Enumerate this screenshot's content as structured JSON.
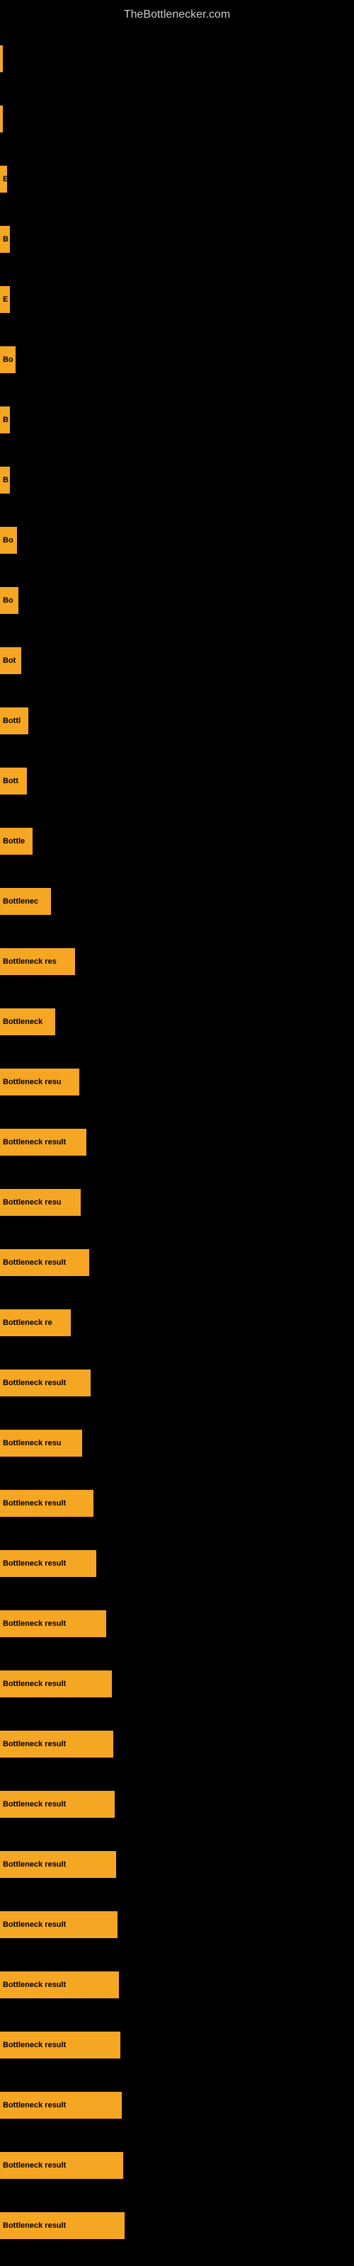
{
  "site": {
    "title": "TheBottlenecker.com"
  },
  "bars": [
    {
      "id": 1,
      "label": "|",
      "width": 4
    },
    {
      "id": 2,
      "label": "|",
      "width": 4
    },
    {
      "id": 3,
      "label": "E",
      "width": 10
    },
    {
      "id": 4,
      "label": "B",
      "width": 14
    },
    {
      "id": 5,
      "label": "E",
      "width": 14
    },
    {
      "id": 6,
      "label": "Bo",
      "width": 22
    },
    {
      "id": 7,
      "label": "B",
      "width": 14
    },
    {
      "id": 8,
      "label": "B",
      "width": 14
    },
    {
      "id": 9,
      "label": "Bo",
      "width": 24
    },
    {
      "id": 10,
      "label": "Bo",
      "width": 26
    },
    {
      "id": 11,
      "label": "Bot",
      "width": 30
    },
    {
      "id": 12,
      "label": "Bottl",
      "width": 40
    },
    {
      "id": 13,
      "label": "Bott",
      "width": 38
    },
    {
      "id": 14,
      "label": "Bottle",
      "width": 46
    },
    {
      "id": 15,
      "label": "Bottlenec",
      "width": 72
    },
    {
      "id": 16,
      "label": "Bottleneck res",
      "width": 106
    },
    {
      "id": 17,
      "label": "Bottleneck",
      "width": 78
    },
    {
      "id": 18,
      "label": "Bottleneck resu",
      "width": 112
    },
    {
      "id": 19,
      "label": "Bottleneck result",
      "width": 122
    },
    {
      "id": 20,
      "label": "Bottleneck resu",
      "width": 114
    },
    {
      "id": 21,
      "label": "Bottleneck result",
      "width": 126
    },
    {
      "id": 22,
      "label": "Bottleneck re",
      "width": 100
    },
    {
      "id": 23,
      "label": "Bottleneck result",
      "width": 128
    },
    {
      "id": 24,
      "label": "Bottleneck resu",
      "width": 116
    },
    {
      "id": 25,
      "label": "Bottleneck result",
      "width": 132
    },
    {
      "id": 26,
      "label": "Bottleneck result",
      "width": 136
    },
    {
      "id": 27,
      "label": "Bottleneck result",
      "width": 150
    },
    {
      "id": 28,
      "label": "Bottleneck result",
      "width": 158
    },
    {
      "id": 29,
      "label": "Bottleneck result",
      "width": 160
    },
    {
      "id": 30,
      "label": "Bottleneck result",
      "width": 162
    },
    {
      "id": 31,
      "label": "Bottleneck result",
      "width": 164
    },
    {
      "id": 32,
      "label": "Bottleneck result",
      "width": 166
    },
    {
      "id": 33,
      "label": "Bottleneck result",
      "width": 168
    },
    {
      "id": 34,
      "label": "Bottleneck result",
      "width": 170
    },
    {
      "id": 35,
      "label": "Bottleneck result",
      "width": 172
    },
    {
      "id": 36,
      "label": "Bottleneck result",
      "width": 174
    },
    {
      "id": 37,
      "label": "Bottleneck result",
      "width": 176
    }
  ]
}
